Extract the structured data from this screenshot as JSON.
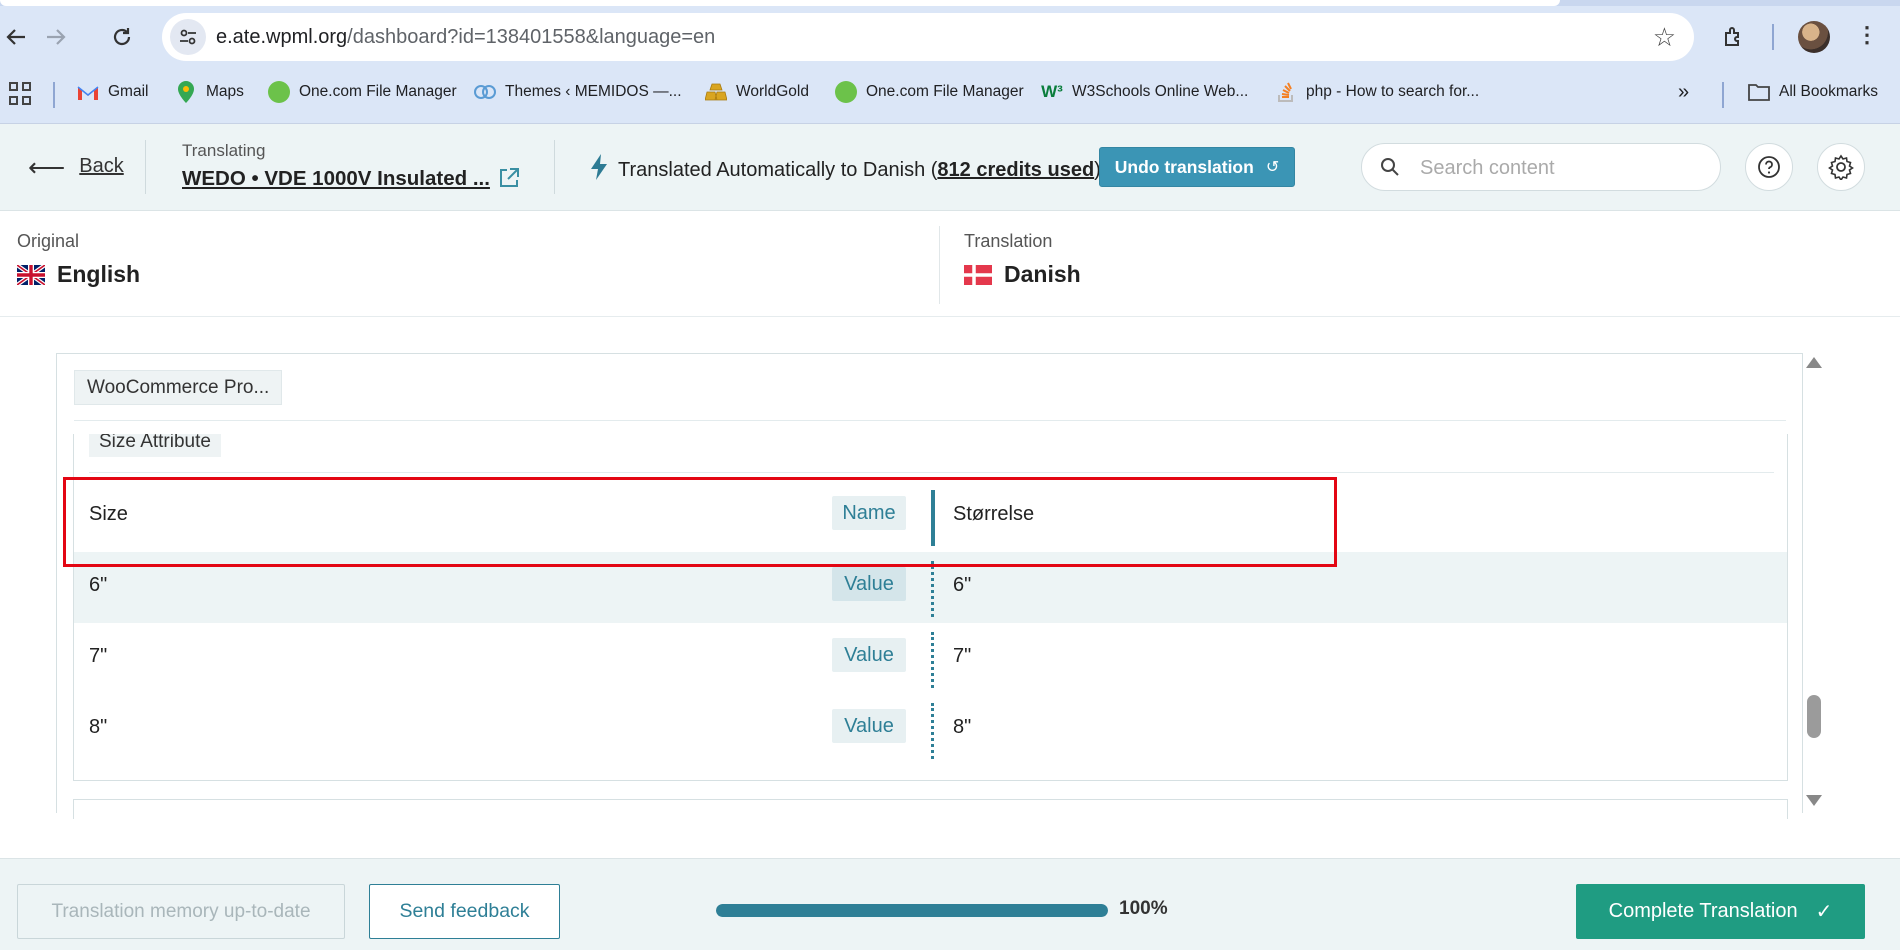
{
  "browser": {
    "url_host": "e.ate.wpml.org",
    "url_path": "/dashboard?id=138401558&language=en",
    "bookmarks": [
      {
        "label": "Gmail",
        "icon": "gmail-icon"
      },
      {
        "label": "Maps",
        "icon": "maps-icon"
      },
      {
        "label": "One.com File Manager",
        "icon": "onecom-icon"
      },
      {
        "label": "Themes ‹ MEMIDOS —...",
        "icon": "wordpress-icon"
      },
      {
        "label": "WorldGold",
        "icon": "gold-icon"
      },
      {
        "label": "One.com File Manager",
        "icon": "onecom-icon"
      },
      {
        "label": "W3Schools Online Web...",
        "icon": "w3schools-icon"
      },
      {
        "label": "php - How to search for...",
        "icon": "stackoverflow-icon"
      }
    ],
    "all_bookmarks_label": "All Bookmarks"
  },
  "header": {
    "back_label": "Back",
    "translating_caption": "Translating",
    "document_title": "WEDO • VDE 1000V Insulated ...",
    "auto_prefix": "Translated Automatically to Danish (",
    "credits": "812 credits used",
    "auto_suffix": ")",
    "undo_label": "Undo translation",
    "search_placeholder": "Search content"
  },
  "languages": {
    "original_caption": "Original",
    "original_name": "English",
    "translation_caption": "Translation",
    "translation_name": "Danish"
  },
  "content": {
    "section_chip": "WooCommerce Pro...",
    "attribute_chip": "Size Attribute",
    "rows": [
      {
        "source": "Size",
        "tag": "Name",
        "target": "Størrelse"
      },
      {
        "source": "6\"",
        "tag": "Value",
        "target": "6\""
      },
      {
        "source": "7\"",
        "tag": "Value",
        "target": "7\""
      },
      {
        "source": "8\"",
        "tag": "Value",
        "target": "8\""
      }
    ]
  },
  "footer": {
    "tm_label": "Translation memory up-to-date",
    "feedback_label": "Send feedback",
    "progress_percent": 100,
    "progress_label": "100%",
    "complete_label": "Complete Translation"
  },
  "colors": {
    "accent": "#2e7f96",
    "undo_bg": "#3b95b5",
    "complete_bg": "#1f9c82",
    "highlight": "#e30613"
  }
}
